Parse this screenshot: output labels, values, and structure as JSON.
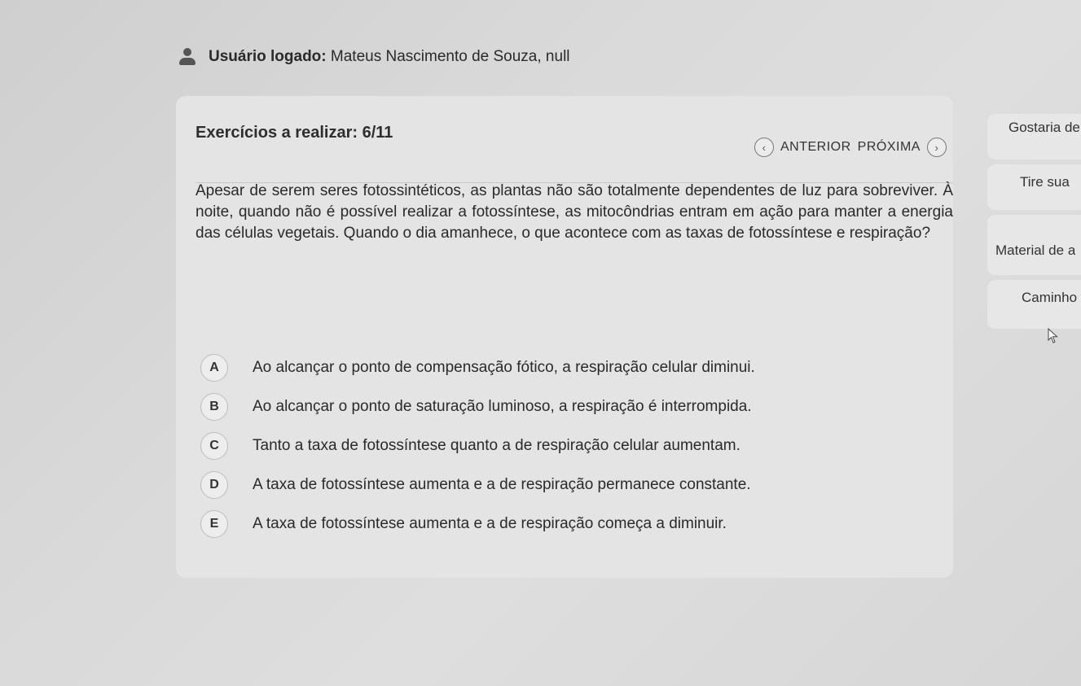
{
  "user": {
    "label": "Usuário logado:",
    "name": "Mateus Nascimento de Souza, null",
    "icon": "user-icon"
  },
  "exercise": {
    "counter": "Exercícios a realizar: 6/11",
    "prev_label": "ANTERIOR",
    "next_label": "PRÓXIMA",
    "prev_icon": "‹",
    "next_icon": "›"
  },
  "question": {
    "text": "Apesar de serem seres fotossintéticos, as plantas não são totalmente dependentes de luz para sobreviver. À noite, quando não é possível realizar a fotossíntese, as mitocôndrias entram em ação para manter a energia das células vegetais. Quando o dia amanhece, o que acontece com as taxas de fotossíntese e respiração?"
  },
  "options": [
    {
      "letter": "A",
      "text": "Ao alcançar o ponto de compensação fótico, a respiração celular diminui."
    },
    {
      "letter": "B",
      "text": "Ao alcançar o ponto de saturação luminoso, a respiração é interrompida."
    },
    {
      "letter": "C",
      "text": "Tanto a taxa de fotossíntese quanto a de respiração celular aumentam."
    },
    {
      "letter": "D",
      "text": "A taxa de fotossíntese aumenta e a de respiração permanece constante."
    },
    {
      "letter": "E",
      "text": "A taxa de fotossíntese aumenta e a de respiração começa a diminuir."
    }
  ],
  "side_panel": {
    "item1": "Gostaria de",
    "item2": "Tire sua",
    "item3": "Material de a",
    "item4": "Caminho"
  },
  "colors": {
    "background": "#d9d9d9",
    "card": "#e4e4e4",
    "text": "#2a2a2a"
  }
}
